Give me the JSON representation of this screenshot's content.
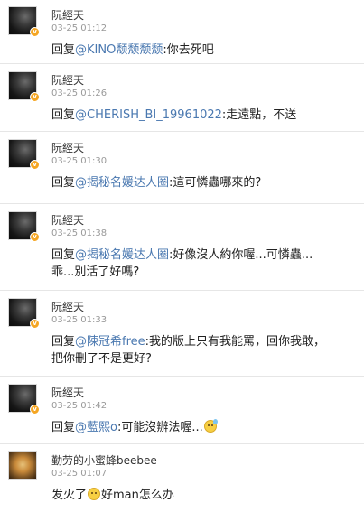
{
  "comments": [
    {
      "name": "阮經天",
      "time": "03-25 01:12",
      "prefix": "回复",
      "mention": "@KINO颓颓颓颓",
      "text": ":你去死吧"
    },
    {
      "name": "阮經天",
      "time": "03-25 01:26",
      "prefix": "回复",
      "mention": "@CHERISH_BI_19961022",
      "text": ":走遠點，不送"
    },
    {
      "name": "阮經天",
      "time": "03-25 01:30",
      "prefix": "回复",
      "mention": "@揭秘名媛达人圈",
      "text": ":這可憐蟲哪來的?"
    },
    {
      "name": "阮經天",
      "time": "03-25 01:38",
      "prefix": "回复",
      "mention": "@揭秘名媛达人圈",
      "text": ":好像沒人約你喔...可憐蟲...",
      "text2": "乖...別活了好嗎?"
    },
    {
      "name": "阮經天",
      "time": "03-25 01:33",
      "prefix": "回复",
      "mention": "@陳冠希free",
      "text": ":我的版上只有我能罵，回你我敢，",
      "text2": "把你刪了不是更好?"
    },
    {
      "name": "阮經天",
      "time": "03-25 01:42",
      "prefix": "回复",
      "mention": "@藍熙o",
      "text": ":可能沒辦法喔...",
      "emoji": "sweat-emoji"
    },
    {
      "name": "勤劳的小蜜蜂beebee",
      "time": "03-25 01:07",
      "text": "发火了",
      "emoji": "smile-emoji",
      "text_after": "好man怎么办"
    }
  ],
  "colors": {
    "mention": "#4a78b0",
    "badge": "#f5a623"
  }
}
